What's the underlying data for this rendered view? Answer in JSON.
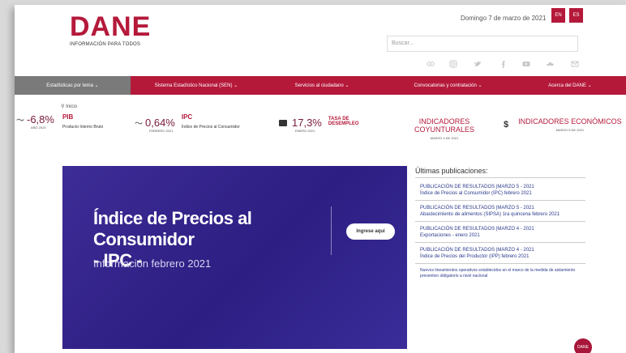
{
  "header": {
    "logo_word": "DANE",
    "logo_tagline": "INFORMACIÓN PARA TODOS",
    "date": "Domingo 7 de marzo de 2021",
    "lang_en": "EN",
    "lang_es": "ES",
    "search_placeholder": "Buscar...",
    "social_icons": [
      "flickr-icon",
      "instagram-icon",
      "twitter-icon",
      "facebook-icon",
      "youtube-icon",
      "soundcloud-icon",
      "email-icon"
    ]
  },
  "nav": {
    "items": [
      {
        "label": "Estadísticas por tema"
      },
      {
        "label": "Sistema Estadístico Nacional (SEN)"
      },
      {
        "label": "Servicios al ciudadano"
      },
      {
        "label": "Convocatorias y contratación"
      },
      {
        "label": "Acerca del DANE"
      }
    ]
  },
  "breadcrumb": {
    "label": "Inicio"
  },
  "indicators": {
    "pib": {
      "value": "-6,8%",
      "date": "AÑO 2020",
      "title": "PIB",
      "desc": "Producto Interno Bruto"
    },
    "ipc": {
      "value": "0,64%",
      "date": "FEBRERO 2021",
      "title": "IPC",
      "desc": "Índice de Precios al Consumidor"
    },
    "desempleo": {
      "value": "17,3%",
      "date": "ENERO 2021",
      "title": "TASA DE",
      "title2": "DESEMPLEO"
    },
    "coyunturales": {
      "title": "INDICADORES COYUNTURALES",
      "date": "MARZO 4 DE 2021"
    },
    "economicos": {
      "title": "INDICADORES ECONÓMICOS",
      "date": "MARZO 5 DE 2021",
      "symbol": "$"
    }
  },
  "banner": {
    "title_line1": "Índice de Precios al Consumidor",
    "title_line2": "- IPC -",
    "subtitle": "Información febrero 2021",
    "button": "Ingrese aquí"
  },
  "publications": {
    "title": "Últimas publicaciones:",
    "items": [
      {
        "line1": "PUBLICACIÓN DE RESULTADOS  |MARZO 5 - 2021",
        "line2": "Índice de Precios al Consumidor (IPC) febrero 2021"
      },
      {
        "line1": "PUBLICACIÓN DE RESULTADOS  |MARZO 5 - 2021",
        "line2": "Abastecimiento de alimentos (SIPSA) 1ra quincena febrero 2021"
      },
      {
        "line1": "PUBLICACIÓN DE RESULTADOS  |MARZO 4 - 2021",
        "line2": "Exportaciones - enero 2021"
      },
      {
        "line1": "PUBLICACIÓN DE RESULTADOS  |MARZO 4 - 2021",
        "line2": "Índice de Precios del Productor (IPP) febrero 2021"
      }
    ],
    "note": "Nuevos lineamientos operativos establecidos en el marco de la medida de aislamiento preventivo obligatorio a nivel nacional"
  },
  "corner_badge": "DANE",
  "colors": {
    "brand": "#b5193a",
    "nav_active": "#7a7a7a",
    "banner": "#2c1e82"
  }
}
